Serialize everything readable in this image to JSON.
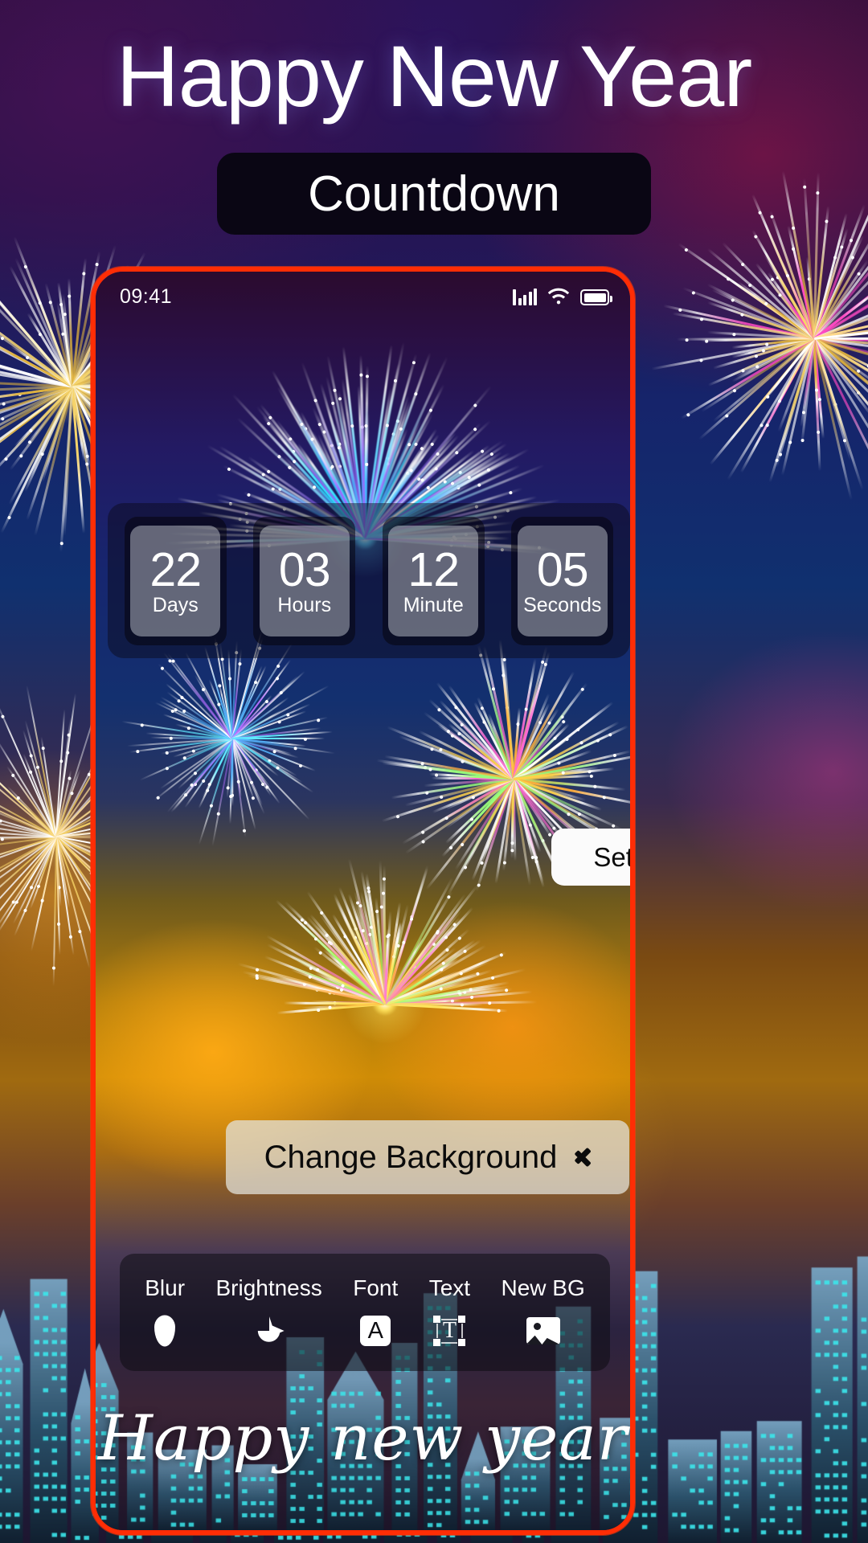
{
  "promo": {
    "title": "Happy New Year",
    "badge_label": "Countdown"
  },
  "status_bar": {
    "time": "09:41",
    "signal_icon": "signal-bars-icon",
    "wifi_icon": "wifi-icon",
    "battery_icon": "battery-icon"
  },
  "countdown": {
    "units": [
      {
        "value": "22",
        "label": "Days"
      },
      {
        "value": "03",
        "label": "Hours"
      },
      {
        "value": "12",
        "label": "Minute"
      },
      {
        "value": "05",
        "label": "Seconds"
      }
    ]
  },
  "actions": {
    "set_time_label": "Set Time",
    "change_background_label": "Change Background",
    "change_background_chevron": "chevron-right-icon"
  },
  "toolbar": {
    "items": [
      {
        "label": "Blur",
        "icon": "water-drop-icon"
      },
      {
        "label": "Brightness",
        "icon": "brightness-icon"
      },
      {
        "label": "Font",
        "icon": "font-a-icon"
      },
      {
        "label": "Text",
        "icon": "text-box-icon"
      },
      {
        "label": "New BG",
        "icon": "image-icon"
      }
    ]
  },
  "greeting": {
    "text": "Happy new year"
  },
  "colors": {
    "frame_red": "#ff2d05",
    "button_white": "#fbfbfb",
    "text_white": "#ffffff",
    "panel_dark": "rgba(10,8,22,0.46)"
  }
}
